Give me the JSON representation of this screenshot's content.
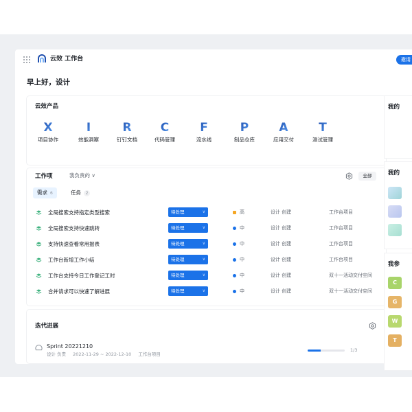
{
  "app": {
    "title": "云效 工作台",
    "invite_label": "邀请"
  },
  "greeting": "早上好，设计",
  "products": {
    "title": "云效产品",
    "items": [
      {
        "label": "项目协作",
        "glyph": "X",
        "icon": "project-icon"
      },
      {
        "label": "效能洞察",
        "glyph": "I",
        "icon": "insight-icon"
      },
      {
        "label": "钉钉文档",
        "glyph": "R",
        "icon": "docs-icon"
      },
      {
        "label": "代码管理",
        "glyph": "C",
        "icon": "code-icon"
      },
      {
        "label": "流水线",
        "glyph": "F",
        "icon": "pipeline-icon"
      },
      {
        "label": "制品仓库",
        "glyph": "P",
        "icon": "packages-icon"
      },
      {
        "label": "应用交付",
        "glyph": "A",
        "icon": "appstack-icon"
      },
      {
        "label": "测试管理",
        "glyph": "T",
        "icon": "testhub-icon"
      }
    ]
  },
  "workitems": {
    "title": "工作项",
    "filter": "我负责的 ∨",
    "scope": "全部",
    "tabs": [
      {
        "label": "需求",
        "count": "6"
      },
      {
        "label": "任务",
        "count": "2"
      }
    ],
    "rows": [
      {
        "title": "全局搜索支持指定类型搜索",
        "status": "待处理",
        "priority": "高",
        "priority_color": "#f5a623",
        "creator": "设计 创建",
        "project": "工作台项目"
      },
      {
        "title": "全局搜索支持快速跳转",
        "status": "待处理",
        "priority": "中",
        "priority_color": "#1b72e8",
        "creator": "设计 创建",
        "project": "工作台项目"
      },
      {
        "title": "支持快速查看常用报表",
        "status": "待处理",
        "priority": "中",
        "priority_color": "#1b72e8",
        "creator": "设计 创建",
        "project": "工作台项目"
      },
      {
        "title": "工作台新增工作小结",
        "status": "待处理",
        "priority": "中",
        "priority_color": "#1b72e8",
        "creator": "设计 创建",
        "project": "工作台项目"
      },
      {
        "title": "工作台支持今日工作登记工时",
        "status": "待处理",
        "priority": "中",
        "priority_color": "#1b72e8",
        "creator": "设计 创建",
        "project": "双十一活动交付空间"
      },
      {
        "title": "合并请求可以快速了解进展",
        "status": "待处理",
        "priority": "中",
        "priority_color": "#1b72e8",
        "creator": "设计 创建",
        "project": "双十一活动交付空间"
      }
    ]
  },
  "iterations": {
    "title": "迭代进展",
    "sprint": {
      "name": "Sprint 20221210",
      "owner": "设计 负责",
      "dates": "2022-11-29 ~ 2022-12-10",
      "project": "工作台项目",
      "progress": 0.35,
      "ratio": "1/3"
    }
  },
  "sidebar": {
    "sections": [
      {
        "title": "我的"
      },
      {
        "title": "我的"
      },
      {
        "title": "我参"
      }
    ],
    "letters": [
      "C",
      "G",
      "W",
      "T"
    ]
  },
  "colors": {
    "accent": "#1b72e8",
    "icon_dark": "#1f4fae",
    "icon_light": "#5aa0f5"
  }
}
